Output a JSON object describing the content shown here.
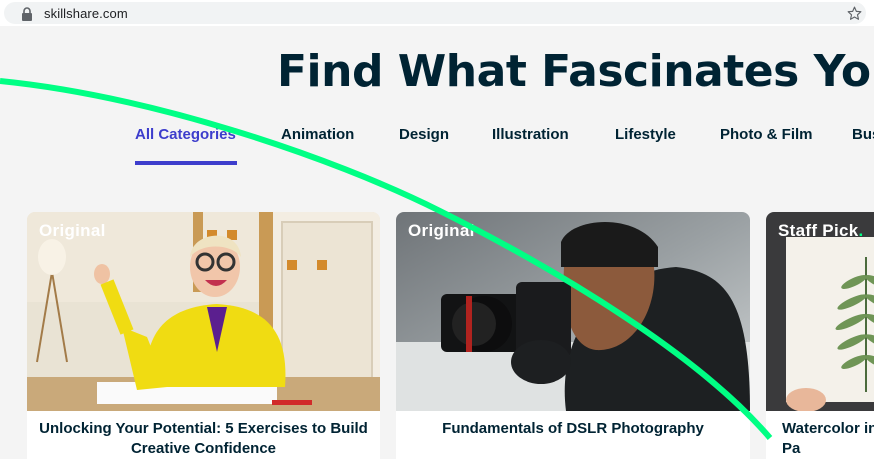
{
  "browser": {
    "url": "skillshare.com"
  },
  "hero": {
    "headline": "Find What Fascinates You"
  },
  "tabs": [
    {
      "label": "All Categories",
      "active": true
    },
    {
      "label": "Animation"
    },
    {
      "label": "Design"
    },
    {
      "label": "Illustration"
    },
    {
      "label": "Lifestyle"
    },
    {
      "label": "Photo & Film"
    },
    {
      "label": "Bus"
    }
  ],
  "cards": [
    {
      "badge": "Original",
      "title": "Unlocking Your Potential: 5 Exercises to Build Creative Confidence"
    },
    {
      "badge": "Original",
      "title": "Fundamentals of DSLR Photography"
    },
    {
      "badge": "Staff Pick",
      "badge_dot": ".",
      "title": "Watercolor in to Pa"
    }
  ],
  "colors": {
    "accent": "#3d3dcc",
    "brand_green": "#00ff84",
    "heading": "#002333"
  },
  "icons": {
    "lock": "lock-icon",
    "bookmark": "star-icon"
  }
}
